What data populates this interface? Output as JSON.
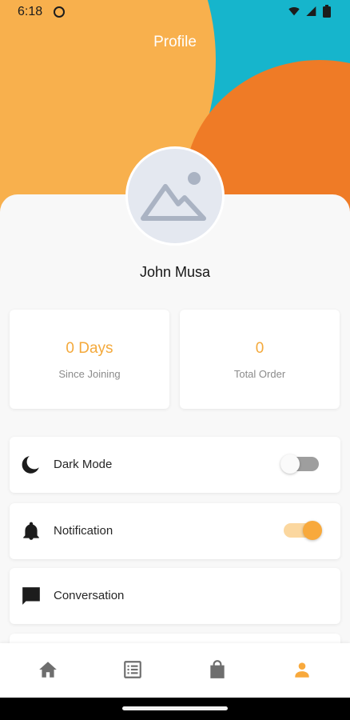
{
  "status_bar": {
    "time": "6:18"
  },
  "header": {
    "title": "Profile"
  },
  "profile": {
    "name": "John Musa"
  },
  "stats": [
    {
      "value": "0 Days",
      "label": "Since Joining"
    },
    {
      "value": "0",
      "label": "Total Order"
    }
  ],
  "settings": [
    {
      "label": "Dark Mode",
      "icon": "moon-icon",
      "toggle": "off"
    },
    {
      "label": "Notification",
      "icon": "bell-icon",
      "toggle": "on"
    },
    {
      "label": "Conversation",
      "icon": "chat-icon",
      "toggle": null
    }
  ],
  "nav": [
    {
      "icon": "home-icon",
      "active": false
    },
    {
      "icon": "list-icon",
      "active": false
    },
    {
      "icon": "shopping-bag-icon",
      "active": false
    },
    {
      "icon": "person-icon",
      "active": true
    }
  ],
  "colors": {
    "accent": "#f8a93c",
    "hero_teal": "#16b5cc",
    "hero_orange": "#f8b04d",
    "hero_red": "#ef7b26",
    "nav_inactive": "#6e6e6e"
  }
}
